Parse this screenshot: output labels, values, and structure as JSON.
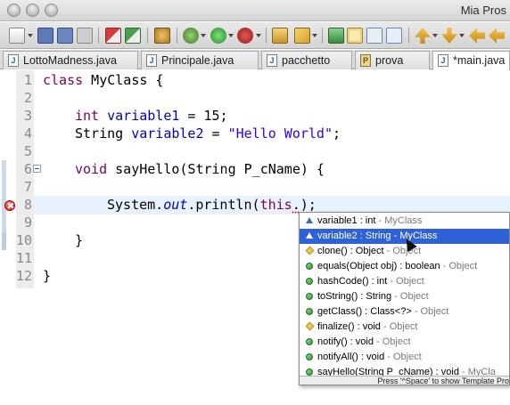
{
  "window": {
    "title": "Mia Pros"
  },
  "tabs": [
    {
      "label": "LottoMadness.java",
      "icon": "java-file-icon"
    },
    {
      "label": "Principale.java",
      "icon": "java-file-icon"
    },
    {
      "label": "pacchetto",
      "icon": "java-file-icon"
    },
    {
      "label": "prova",
      "icon": "package-icon"
    },
    {
      "label": "*main.java",
      "icon": "java-file-icon"
    }
  ],
  "editor": {
    "line_numbers": [
      "1",
      "2",
      "3",
      "4",
      "5",
      "6",
      "7",
      "8",
      "9",
      "10",
      "11",
      "12"
    ],
    "lines": {
      "l1_kw": "class",
      "l1_rest": " MyClass {",
      "l3_kw": "int",
      "l3_field": "variable1",
      "l3_rest": " = 15;",
      "l4_type": "String ",
      "l4_field": "variable2",
      "l4_eq": " = ",
      "l4_str": "\"Hello World\"",
      "l4_end": ";",
      "l6_kw": "void",
      "l6_rest": " sayHello(String P_cName) {",
      "l8_pre": "System.",
      "l8_static": "out",
      "l8_mid": ".println(",
      "l8_kw": "this",
      "l8_end": ".);",
      "l10": "}",
      "l12": "}"
    }
  },
  "completion": {
    "items": [
      {
        "name": "variable1 : int",
        "owner": " - MyClass",
        "icon": "field-icon",
        "selected": false
      },
      {
        "name": "variable2 : String",
        "owner": " - MyClass",
        "icon": "field-icon",
        "selected": true
      },
      {
        "name": "clone() : Object",
        "owner": " - Object",
        "icon": "protected-method-icon",
        "selected": false
      },
      {
        "name": "equals(Object obj) : boolean",
        "owner": " - Object",
        "icon": "public-method-icon",
        "selected": false
      },
      {
        "name": "hashCode() : int",
        "owner": " - Object",
        "icon": "public-method-icon",
        "selected": false
      },
      {
        "name": "toString() : String",
        "owner": " - Object",
        "icon": "public-method-icon",
        "selected": false
      },
      {
        "name": "getClass() : Class<?>",
        "owner": " - Object",
        "icon": "public-method-icon",
        "selected": false
      },
      {
        "name": "finalize() : void",
        "owner": " - Object",
        "icon": "protected-method-icon",
        "selected": false
      },
      {
        "name": "notify() : void",
        "owner": " - Object",
        "icon": "public-method-icon",
        "selected": false
      },
      {
        "name": "notifyAll() : void",
        "owner": " - Object",
        "icon": "public-method-icon",
        "selected": false
      },
      {
        "name": "sayHello(String P_cName) : void",
        "owner": " - MyCla",
        "icon": "public-method-icon",
        "selected": false
      }
    ],
    "footer": "Press '^Space' to show Template Pro"
  }
}
